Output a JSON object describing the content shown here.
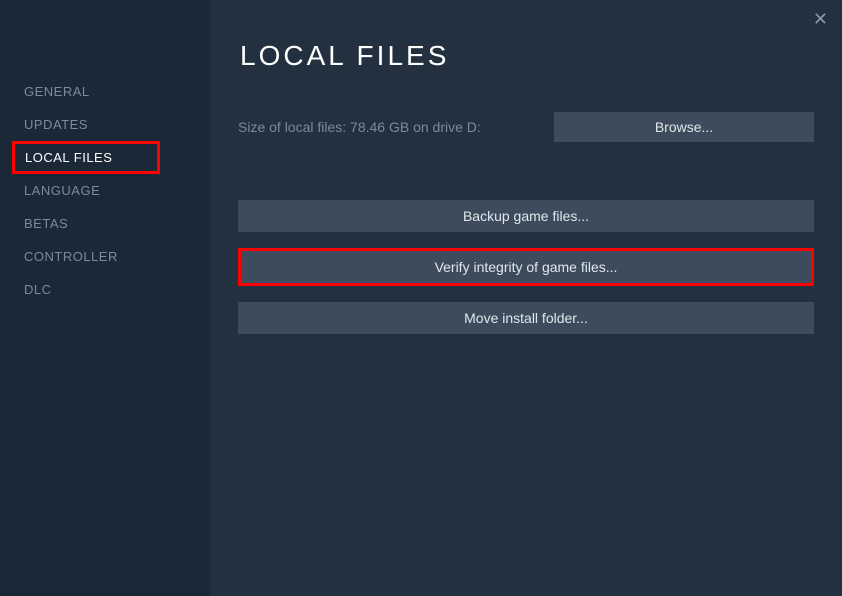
{
  "sidebar": {
    "items": [
      {
        "label": "GENERAL"
      },
      {
        "label": "UPDATES"
      },
      {
        "label": "LOCAL FILES"
      },
      {
        "label": "LANGUAGE"
      },
      {
        "label": "BETAS"
      },
      {
        "label": "CONTROLLER"
      },
      {
        "label": "DLC"
      }
    ]
  },
  "main": {
    "title": "LOCAL FILES",
    "size_text": "Size of local files: 78.46 GB on drive D:",
    "browse_label": "Browse...",
    "buttons": {
      "backup": "Backup game files...",
      "verify": "Verify integrity of game files...",
      "move": "Move install folder..."
    }
  }
}
